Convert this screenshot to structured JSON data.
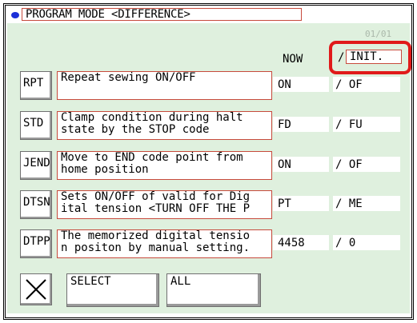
{
  "title": "PROGRAM MODE <DIFFERENCE>",
  "page_indicator": "01/01",
  "columns": {
    "now": "NOW",
    "init": "INIT."
  },
  "rows": [
    {
      "code": "RPT",
      "description": "Repeat sewing ON/OFF",
      "now": "ON",
      "init": "/ OF"
    },
    {
      "code": "STD",
      "description": "Clamp condition during halt\nstate by the STOP code",
      "now": "FD",
      "init": "/ FU"
    },
    {
      "code": "JEND",
      "description": "Move to END code point from\nhome position",
      "now": "ON",
      "init": "/ OF"
    },
    {
      "code": "DTSN",
      "description": "Sets ON/OFF of valid for Dig\nital tension <TURN OFF THE P",
      "now": "PT",
      "init": "/ ME"
    },
    {
      "code": "DTPP",
      "description": "The memorized digital tensio\nn positon by manual setting.",
      "now": "4458",
      "init": "/ 0"
    }
  ],
  "buttons": {
    "cancel_icon": "close-icon",
    "select": "SELECT",
    "all": "ALL"
  },
  "colors": {
    "screen_bg": "#dff0de",
    "field_border": "#c74a3c",
    "highlight": "#e01a1a",
    "title_dot": "#1b2fd8"
  }
}
